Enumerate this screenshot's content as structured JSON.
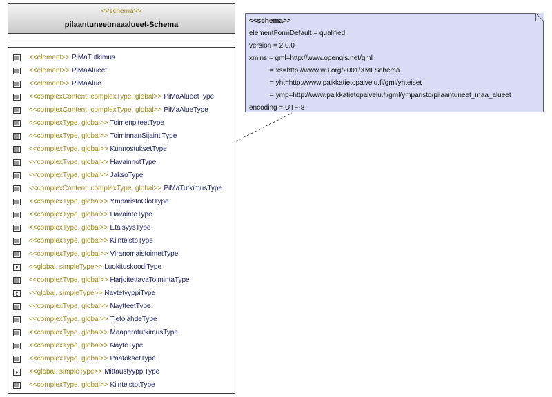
{
  "class": {
    "stereotype": "<<schema>>",
    "name": "pilaantuneetmaaalueet-Schema",
    "items": [
      {
        "icon": "list-icon",
        "stereo": "<<element>>",
        "name": "PiMaTutkimus"
      },
      {
        "icon": "list-icon",
        "stereo": "<<element>>",
        "name": "PiMaAlueet"
      },
      {
        "icon": "list-icon",
        "stereo": "<<element>>",
        "name": "PiMaAlue"
      },
      {
        "icon": "list-icon",
        "stereo": "<<complexContent, complexType, global>>",
        "name": "PiMaAlueetType"
      },
      {
        "icon": "list-icon",
        "stereo": "<<complexContent, complexType, global>>",
        "name": "PiMaAlueType"
      },
      {
        "icon": "list-icon",
        "stereo": "<<complexType, global>>",
        "name": "ToimenpiteetType"
      },
      {
        "icon": "list-icon",
        "stereo": "<<complexType, global>>",
        "name": "ToiminnanSijaintiType"
      },
      {
        "icon": "list-icon",
        "stereo": "<<complexType, global>>",
        "name": "KunnostuksetType"
      },
      {
        "icon": "list-icon",
        "stereo": "<<complexType, global>>",
        "name": "HavainnotType"
      },
      {
        "icon": "list-icon",
        "stereo": "<<complexType, global>>",
        "name": "JaksoType"
      },
      {
        "icon": "list-icon",
        "stereo": "<<complexContent, complexType, global>>",
        "name": "PiMaTutkimusType"
      },
      {
        "icon": "list-icon",
        "stereo": "<<complexType, global>>",
        "name": "YmparistoOlotType"
      },
      {
        "icon": "list-icon",
        "stereo": "<<complexType, global>>",
        "name": "HavaintoType"
      },
      {
        "icon": "list-icon",
        "stereo": "<<complexType, global>>",
        "name": "EtaisyysType"
      },
      {
        "icon": "list-icon",
        "stereo": "<<complexType, global>>",
        "name": "KiinteistoType"
      },
      {
        "icon": "list-icon",
        "stereo": "<<complexType, global>>",
        "name": "ViranomaistoimetType"
      },
      {
        "icon": "enum-icon",
        "stereo": "<<global, simpleType>>",
        "name": "LuokituskoodiType"
      },
      {
        "icon": "list-icon",
        "stereo": "<<complexType, global>>",
        "name": "HarjoitettavaToimintaType"
      },
      {
        "icon": "enum-icon",
        "stereo": "<<global, simpleType>>",
        "name": "NaytetyyppiType"
      },
      {
        "icon": "list-icon",
        "stereo": "<<complexType, global>>",
        "name": "NaytteetType"
      },
      {
        "icon": "list-icon",
        "stereo": "<<complexType, global>>",
        "name": "TietolahdeType"
      },
      {
        "icon": "list-icon",
        "stereo": "<<complexType, global>>",
        "name": "MaaperatutkimusType"
      },
      {
        "icon": "list-icon",
        "stereo": "<<complexType, global>>",
        "name": "NayteType"
      },
      {
        "icon": "list-icon",
        "stereo": "<<complexType, global>>",
        "name": "PaatoksetType"
      },
      {
        "icon": "enum-icon",
        "stereo": "<<global, simpleType>>",
        "name": "MittaustyyppiType"
      },
      {
        "icon": "list-icon",
        "stereo": "<<complexType, global>>",
        "name": "KiinteistotType"
      }
    ]
  },
  "note": {
    "title": "<<schema>>",
    "lines": [
      "elementFormDefault = qualified",
      "version = 2.0.0",
      "xmlns = gml=http://www.opengis.net/gml"
    ],
    "ns_lines": [
      "= xs=http://www.w3.org/2001/XMLSchema",
      "= yht=http://www.paikkatietopalvelu.fi/gml/yhteiset",
      "= ymp=http://www.paikkatietopalvelu.fi/gml/ymparisto/pilaantuneet_maa_alueet"
    ],
    "encoding": "encoding = UTF-8"
  },
  "colors": {
    "stereotype": "#a28c1c",
    "name": "#202060",
    "note_fill": "#d9dcf4"
  }
}
